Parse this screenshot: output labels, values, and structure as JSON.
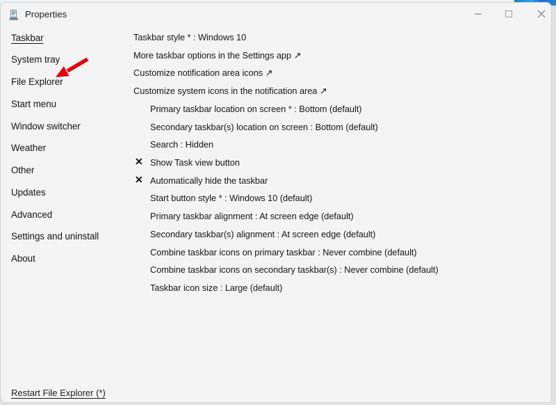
{
  "window": {
    "title": "Properties",
    "icon": "properties-app-icon",
    "controls": {
      "minimize_label": "Minimize",
      "maximize_label": "Maximize",
      "close_label": "Close"
    }
  },
  "sidebar": {
    "items": [
      {
        "label": "Taskbar"
      },
      {
        "label": "System tray"
      },
      {
        "label": "File Explorer"
      },
      {
        "label": "Start menu"
      },
      {
        "label": "Window switcher"
      },
      {
        "label": "Weather"
      },
      {
        "label": "Other"
      },
      {
        "label": "Updates"
      },
      {
        "label": "Advanced"
      },
      {
        "label": "Settings and uninstall"
      },
      {
        "label": "About"
      }
    ],
    "selected": "Taskbar"
  },
  "main": {
    "rows": [
      {
        "mark": "",
        "text": "Taskbar style * : Windows 10"
      },
      {
        "mark": "",
        "text": "More taskbar options in the Settings app ↗"
      },
      {
        "mark": "",
        "text": "Customize notification area icons ↗"
      },
      {
        "mark": "",
        "text": "Customize system icons in the notification area ↗"
      },
      {
        "mark": "",
        "text": "Primary taskbar location on screen * : Bottom (default)"
      },
      {
        "mark": "",
        "text": "Secondary taskbar(s) location on screen : Bottom (default)"
      },
      {
        "mark": "",
        "text": "Search : Hidden"
      },
      {
        "mark": "✕",
        "text": "Show Task view button"
      },
      {
        "mark": "✕",
        "text": "Automatically hide the taskbar"
      },
      {
        "mark": "",
        "text": "Start button style * : Windows 10 (default)"
      },
      {
        "mark": "",
        "text": "Primary taskbar alignment : At screen edge (default)"
      },
      {
        "mark": "",
        "text": "Secondary taskbar(s) alignment : At screen edge (default)"
      },
      {
        "mark": "",
        "text": "Combine taskbar icons on primary taskbar : Never combine (default)"
      },
      {
        "mark": "",
        "text": "Combine taskbar icons on secondary taskbar(s) : Never combine (default)"
      },
      {
        "mark": "",
        "text": "Taskbar icon size : Large (default)"
      }
    ]
  },
  "footer": {
    "restart_link": "Restart File Explorer (*)"
  },
  "annotation": {
    "arrow_color": "#e2000f",
    "points_at": "File Explorer"
  },
  "colors": {
    "window_background": "#f3f3f3",
    "text": "#161616",
    "wallpaper_blue": "#1c7fd0"
  }
}
